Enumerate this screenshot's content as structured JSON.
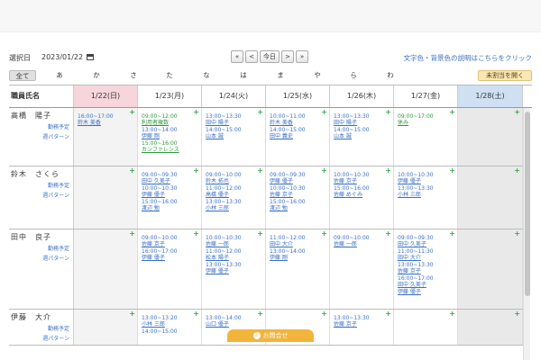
{
  "toolbar": {
    "date_label": "選択日",
    "date_value": "2023/01/22",
    "nav": [
      "«",
      "<",
      "今日",
      ">",
      "»"
    ],
    "help_link": "文字色・背景色の説明はこちらをクリック"
  },
  "kana_tabs": [
    "全て",
    "あ",
    "か",
    "さ",
    "た",
    "な",
    "は",
    "ま",
    "や",
    "ら",
    "わ"
  ],
  "reassign_label": "未割当を開く",
  "columns": {
    "name_header": "職員氏名",
    "days": [
      "1/22(日)",
      "1/23(月)",
      "1/24(火)",
      "1/25(水)",
      "1/26(木)",
      "1/27(金)",
      "1/28(土)"
    ]
  },
  "plus_glyph": "+",
  "inquiry_label": "お問合せ",
  "inquiry_icon": "?",
  "colors": {
    "today_header": "#f6d5dd",
    "saturday_header": "#cfe0f3",
    "accent_link": "#3b6fc4",
    "green": "#2e9a3b",
    "inquiry": "#f2b43b"
  },
  "employees": [
    {
      "name": "高橋　陽子",
      "sub1": "勤務予定",
      "sub2": "週パターン",
      "days": [
        [
          {
            "t": "16:00~17:00",
            "n": "鈴木 美香"
          }
        ],
        [
          {
            "t": "09:00~12:00",
            "n": "利用者複数",
            "green": true
          },
          {
            "t": "13:00~14:00",
            "n": "伊藤 剛"
          },
          {
            "t": "15:00~16:00",
            "n": "カンファレンス",
            "green": true
          }
        ],
        [
          {
            "t": "13:00~13:30",
            "n": "田中 陽子"
          },
          {
            "t": "14:00~15:00",
            "n": "山本 誠"
          }
        ],
        [
          {
            "t": "10:00~11:00",
            "n": "鈴木 美香"
          },
          {
            "t": "14:00~15:00",
            "n": "田中 義史"
          }
        ],
        [
          {
            "t": "13:00~13:30",
            "n": "田中 陽子"
          },
          {
            "t": "14:00~15:00",
            "n": "山本 誠"
          }
        ],
        [
          {
            "t": "09:00~17:00",
            "n": "休み",
            "green": true
          }
        ],
        []
      ]
    },
    {
      "name": "鈴木　さくら",
      "sub1": "勤務予定",
      "sub2": "週パターン",
      "days": [
        [],
        [
          {
            "t": "09:00~09:30",
            "n": "田中 久美子"
          },
          {
            "t": "10:00~10:30",
            "n": "伊藤 優子"
          },
          {
            "t": "15:00~16:00",
            "n": "渡辺 勉"
          }
        ],
        [
          {
            "t": "09:00~10:00",
            "n": "鈴木 拓也"
          },
          {
            "t": "11:00~12:00",
            "n": "高橋 優子"
          },
          {
            "t": "13:00~13:30",
            "n": "小林 三郎"
          }
        ],
        [
          {
            "t": "09:00~09:30",
            "n": "伊藤 優子"
          },
          {
            "t": "10:00~10:30",
            "n": "佐藤 京子"
          },
          {
            "t": "15:00~16:00",
            "n": "渡辺 勉"
          }
        ],
        [
          {
            "t": "10:00~10:30",
            "n": "佐藤 京子"
          },
          {
            "t": "15:00~16:00",
            "n": "佐藤 めぐみ"
          }
        ],
        [
          {
            "t": "10:00~10:30",
            "n": "伊藤 優子"
          },
          {
            "t": "13:00~13:30",
            "n": "小林 三郎"
          }
        ],
        []
      ]
    },
    {
      "name": "田中　良子",
      "sub1": "勤務予定",
      "sub2": "週パターン",
      "days": [
        [],
        [
          {
            "t": "09:00~10:00",
            "n": "佐藤 京子"
          },
          {
            "t": "16:00~17:00",
            "n": "伊藤 優子"
          }
        ],
        [
          {
            "t": "10:00~10:30",
            "n": "佐藤 一郎"
          },
          {
            "t": "11:00~12:00",
            "n": "松本 陽子"
          },
          {
            "t": "13:00~13:30",
            "n": "伊藤 優子"
          }
        ],
        [
          {
            "t": "11:00~12:00",
            "n": "田中 大介"
          },
          {
            "t": "13:00~14:00",
            "n": "伊藤 剛"
          }
        ],
        [
          {
            "t": "09:00~10:00",
            "n": "佐藤 一郎"
          }
        ],
        [
          {
            "t": "09:00~09:30",
            "n": "田中 久美子"
          },
          {
            "t": "11:00~11:30",
            "n": "田中 大介"
          },
          {
            "t": "13:00~13:30",
            "n": "佐藤 京子"
          },
          {
            "t": "16:00~17:00",
            "n": "田中 久美子"
          },
          {
            "t": "",
            "n": "伊藤 優子"
          }
        ],
        []
      ]
    },
    {
      "name": "伊藤　大介",
      "sub1": "勤務予定",
      "sub2": "週パターン",
      "days": [
        [],
        [
          {
            "t": "13:00~13:20",
            "n": "小林 三郎"
          },
          {
            "t": "14:00~15:00",
            "n": ""
          }
        ],
        [
          {
            "t": "13:00~14:00",
            "n": "山口 優子"
          }
        ],
        [],
        [
          {
            "t": "13:00~13:30",
            "n": "佐藤 京子"
          }
        ],
        [],
        []
      ]
    }
  ]
}
